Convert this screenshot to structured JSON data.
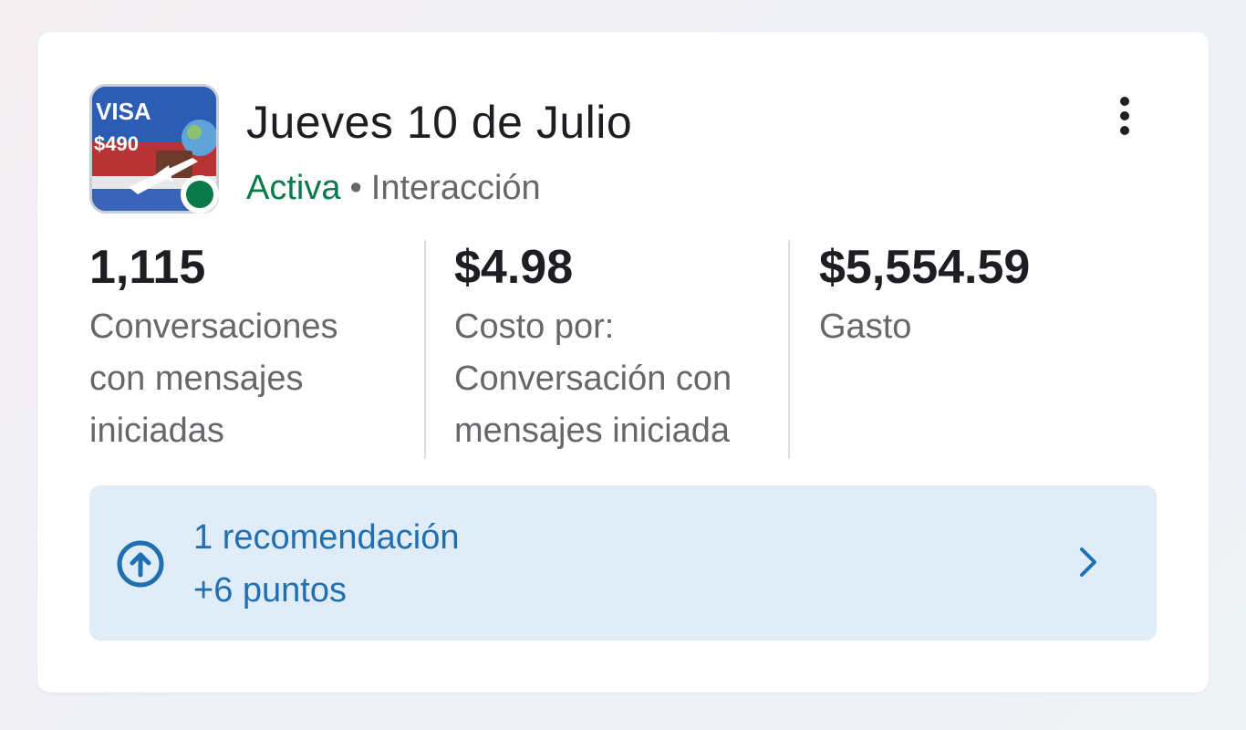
{
  "campaign": {
    "title": "Jueves 10 de Julio",
    "status": "Activa",
    "separator": "•",
    "objective": "Interacción",
    "status_color": "#0a7a4a",
    "thumbnail": {
      "icon": "ad-thumbnail-image",
      "text_top": "VISA",
      "text_price": "$490"
    }
  },
  "menu": {
    "icon": "more-vertical-icon"
  },
  "metrics": [
    {
      "value": "1,115",
      "label_lines": [
        "Conversaciones",
        "con mensajes",
        "iniciadas"
      ]
    },
    {
      "value": "$4.98",
      "label_lines": [
        "Costo por:",
        "Conversación con",
        "mensajes iniciada"
      ]
    },
    {
      "value": "$5,554.59",
      "label_lines": [
        "Gasto"
      ]
    }
  ],
  "recommendation": {
    "title": "1 recomendación",
    "points": "+6 puntos",
    "icon": "arrow-up-circle-icon",
    "chevron_icon": "chevron-right-icon",
    "accent_color": "#1f6fb2",
    "background": "#e0ecf7"
  }
}
